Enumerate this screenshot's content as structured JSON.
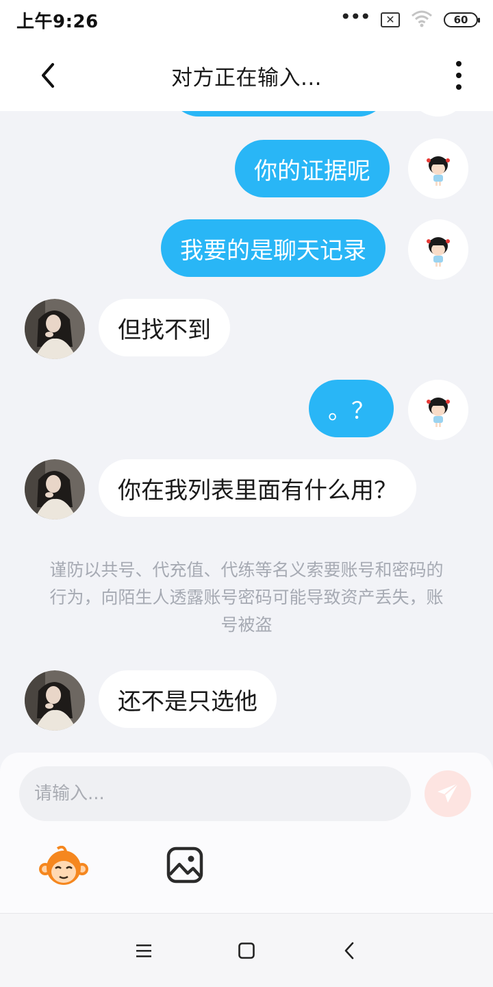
{
  "status_bar": {
    "time": "上午9:26",
    "battery": "60",
    "icons": [
      "more-dots-icon",
      "sim-off-icon",
      "wifi-icon",
      "battery-icon"
    ]
  },
  "header": {
    "title": "对方正在输入...",
    "back_icon": "chevron-left-icon",
    "more_icon": "vertical-dots-icon"
  },
  "messages": [
    {
      "side": "mine",
      "text": "你的证据呢"
    },
    {
      "side": "mine",
      "text": "我要的是聊天记录"
    },
    {
      "side": "theirs",
      "text": "但找不到"
    },
    {
      "side": "mine",
      "text": "。？"
    },
    {
      "side": "theirs",
      "text": "你在我列表里面有什么用？"
    },
    {
      "side": "theirs",
      "text": "还不是只选他"
    }
  ],
  "notice": "谨防以共号、代充值、代练等名义索要账号和密码的行为，向陌生人透露账号密码可能导致资产丢失，账号被盗",
  "input": {
    "placeholder": "请输入...",
    "value": ""
  },
  "toolbar": {
    "send_icon": "paper-plane-icon",
    "emoji_icon": "monkey-emoji-icon",
    "image_icon": "image-icon"
  },
  "nav_bar": {
    "icons": [
      "menu-icon",
      "home-square-icon",
      "back-chevron-icon"
    ]
  },
  "colors": {
    "my_bubble": "#29b6f6",
    "their_bubble": "#ffffff",
    "chat_background": "#f2f3f7",
    "send_button": "#fde4e1",
    "send_icon": "#ffffff"
  }
}
